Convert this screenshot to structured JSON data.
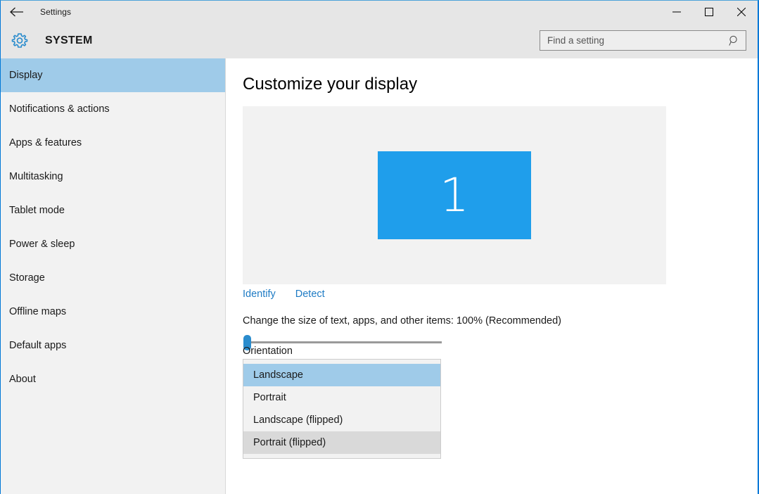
{
  "window": {
    "title": "Settings",
    "back_icon": "back-arrow-icon",
    "minimize_label": "─",
    "maximize_label": "□",
    "close_label": "✕",
    "border_color": "#0078d7"
  },
  "header": {
    "gear_icon": "gear-icon",
    "category": "SYSTEM",
    "search": {
      "placeholder": "Find a setting",
      "value": "",
      "icon": "search-icon"
    },
    "background": "#e6e6e6"
  },
  "sidebar": {
    "background": "#f2f2f2",
    "selected_color": "#9fcbe9",
    "items": [
      {
        "label": "Display",
        "selected": true
      },
      {
        "label": "Notifications & actions",
        "selected": false
      },
      {
        "label": "Apps & features",
        "selected": false
      },
      {
        "label": "Multitasking",
        "selected": false
      },
      {
        "label": "Tablet mode",
        "selected": false
      },
      {
        "label": "Power & sleep",
        "selected": false
      },
      {
        "label": "Storage",
        "selected": false
      },
      {
        "label": "Offline maps",
        "selected": false
      },
      {
        "label": "Default apps",
        "selected": false
      },
      {
        "label": "About",
        "selected": false
      }
    ]
  },
  "main": {
    "page_title": "Customize your display",
    "monitor_preview": {
      "number": "1",
      "color": "#1f9eeb",
      "panel_background": "#f2f2f2"
    },
    "links": [
      {
        "label": "Identify"
      },
      {
        "label": "Detect"
      }
    ],
    "link_color": "#1e7bc4",
    "scale_slider": {
      "label": "Change the size of text, apps, and other items: 100% (Recommended)",
      "value": "100%",
      "position_percent": 0,
      "thumb_color": "#2a8ccd",
      "track_color": "#9a9a9a"
    },
    "orientation": {
      "label": "Orientation",
      "options": [
        {
          "label": "Landscape",
          "state": "selected"
        },
        {
          "label": "Portrait",
          "state": "normal"
        },
        {
          "label": "Landscape (flipped)",
          "state": "normal"
        },
        {
          "label": "Portrait (flipped)",
          "state": "hovered"
        }
      ]
    }
  }
}
